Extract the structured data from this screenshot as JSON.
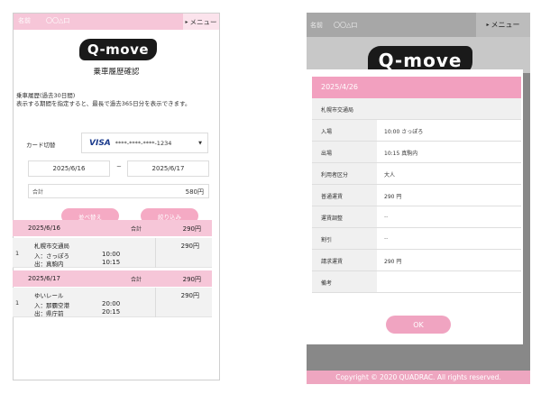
{
  "left": {
    "header": {
      "name_label": "名前",
      "name_value": "〇〇△口",
      "menu_arrow": "▸",
      "menu_label": "メニュー"
    },
    "logo_text": "Q-move",
    "page_title": "乗車履歴確認",
    "description_line1": "乗車履歴(過去30日間)",
    "description_line2": "表示する期間を指定すると、最長で過去365日分を表示できます。",
    "card": {
      "label": "カード切替",
      "brand": "VISA",
      "number": "****-****-****-1234",
      "caret": "▼"
    },
    "date_range": {
      "start": "2025/6/16",
      "separator": "~",
      "end": "2025/6/17"
    },
    "total": {
      "label": "合計",
      "value": "580円"
    },
    "buttons": {
      "sort": "並べ替え",
      "filter": "絞り込み"
    },
    "groups": [
      {
        "date": "2025/6/16",
        "total_label": "合計",
        "total": "290円",
        "row": {
          "index": "1",
          "operator": "札幌市交通局",
          "entry": "入：さっぽろ",
          "exit": "出：真駒内",
          "time_in": "10:00",
          "time_out": "10:15",
          "amount": "290円"
        }
      },
      {
        "date": "2025/6/17",
        "total_label": "合計",
        "total": "290円",
        "row": {
          "index": "1",
          "operator": "ゆいレール",
          "entry": "入：那覇空港",
          "exit": "出：県庁前",
          "time_in": "20:00",
          "time_out": "20:15",
          "amount": "290円"
        }
      }
    ]
  },
  "right": {
    "header": {
      "name_label": "名前",
      "name_value": "〇〇△口",
      "menu_arrow": "▸",
      "menu_label": "メニュー"
    },
    "logo_text": "Q-move",
    "modal": {
      "date": "2025/4/26",
      "operator": "札幌市交通局",
      "rows": [
        {
          "label": "入場",
          "value": "10:00 さっぽろ"
        },
        {
          "label": "出場",
          "value": "10:15 真駒内"
        },
        {
          "label": "利用者区分",
          "value": "大人"
        },
        {
          "label": "普通運賃",
          "value": "290 円"
        },
        {
          "label": "運賃調整",
          "value": "--"
        },
        {
          "label": "割引",
          "value": "--"
        },
        {
          "label": "請求運賃",
          "value": "290 円"
        },
        {
          "label": "備考",
          "value": ""
        }
      ],
      "ok_label": "OK"
    },
    "footer": "Copyright © 2020 QUADRAC. All rights reserved."
  }
}
